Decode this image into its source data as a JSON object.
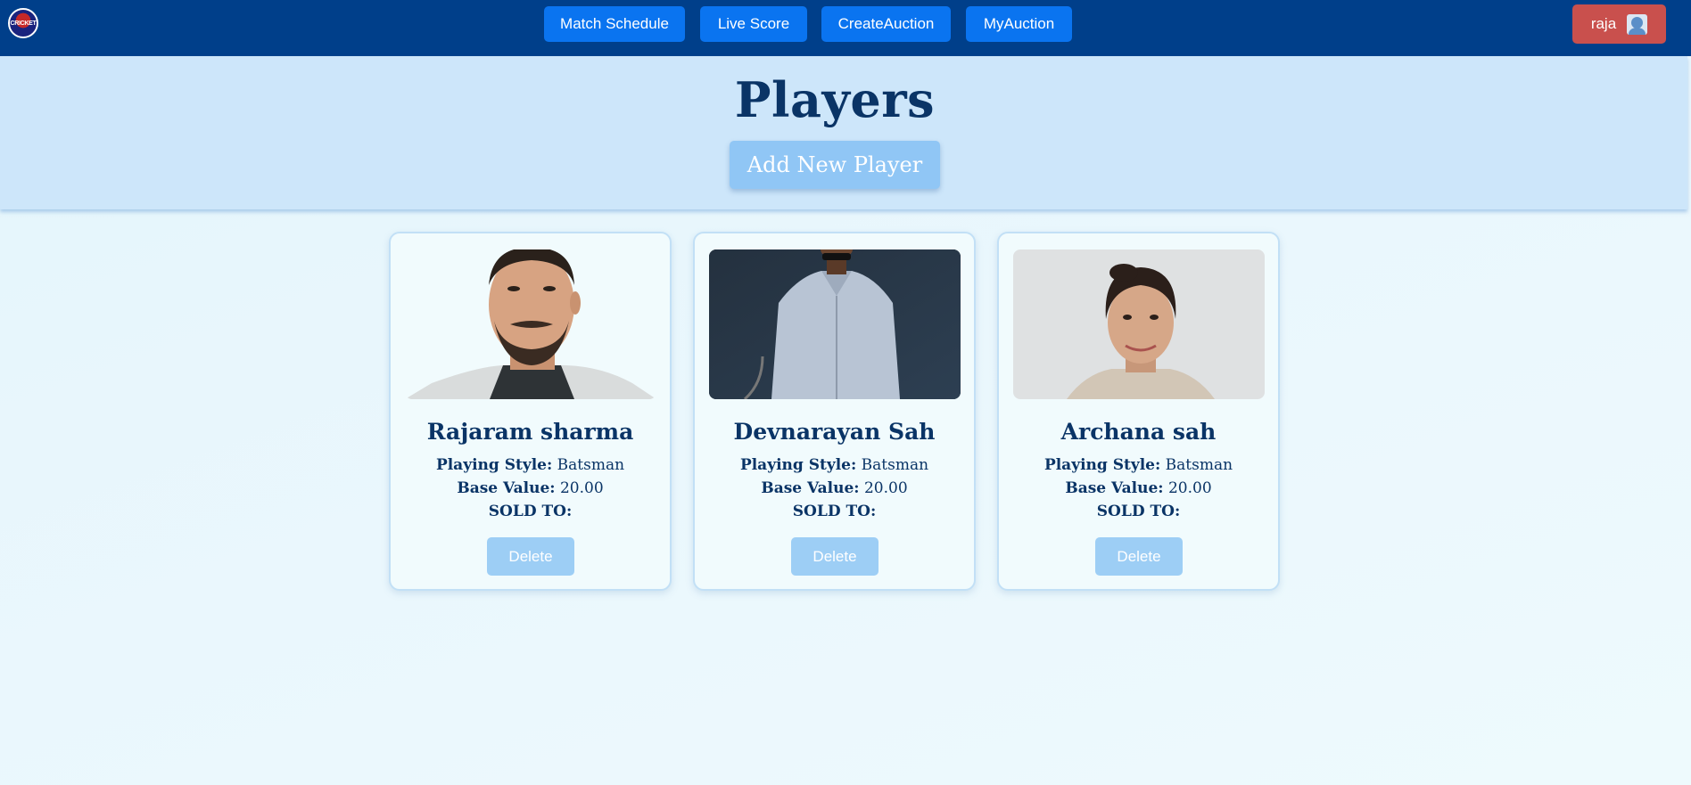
{
  "navbar": {
    "logo_text": "CRICKET",
    "buttons": [
      "Match Schedule",
      "Live Score",
      "CreateAuction",
      "MyAuction"
    ],
    "user": {
      "name": "raja",
      "icon": "user-avatar-icon"
    },
    "colors": {
      "bar": "#003f8a",
      "nav_button": "#0a74f0",
      "user_button": "#c9504d"
    }
  },
  "header": {
    "title": "Players",
    "add_button": "Add New Player"
  },
  "players": [
    {
      "name": "Rajaram sharma",
      "style_label": "Playing Style:",
      "style": "Batsman",
      "base_label": "Base Value:",
      "base_value": "20.00",
      "sold_label": "SOLD TO:",
      "sold_to": "",
      "delete_label": "Delete"
    },
    {
      "name": "Devnarayan Sah",
      "style_label": "Playing Style:",
      "style": "Batsman",
      "base_label": "Base Value:",
      "base_value": "20.00",
      "sold_label": "SOLD TO:",
      "sold_to": "",
      "delete_label": "Delete"
    },
    {
      "name": "Archana sah",
      "style_label": "Playing Style:",
      "style": "Batsman",
      "base_label": "Base Value:",
      "base_value": "20.00",
      "sold_label": "SOLD TO:",
      "sold_to": "",
      "delete_label": "Delete"
    }
  ]
}
